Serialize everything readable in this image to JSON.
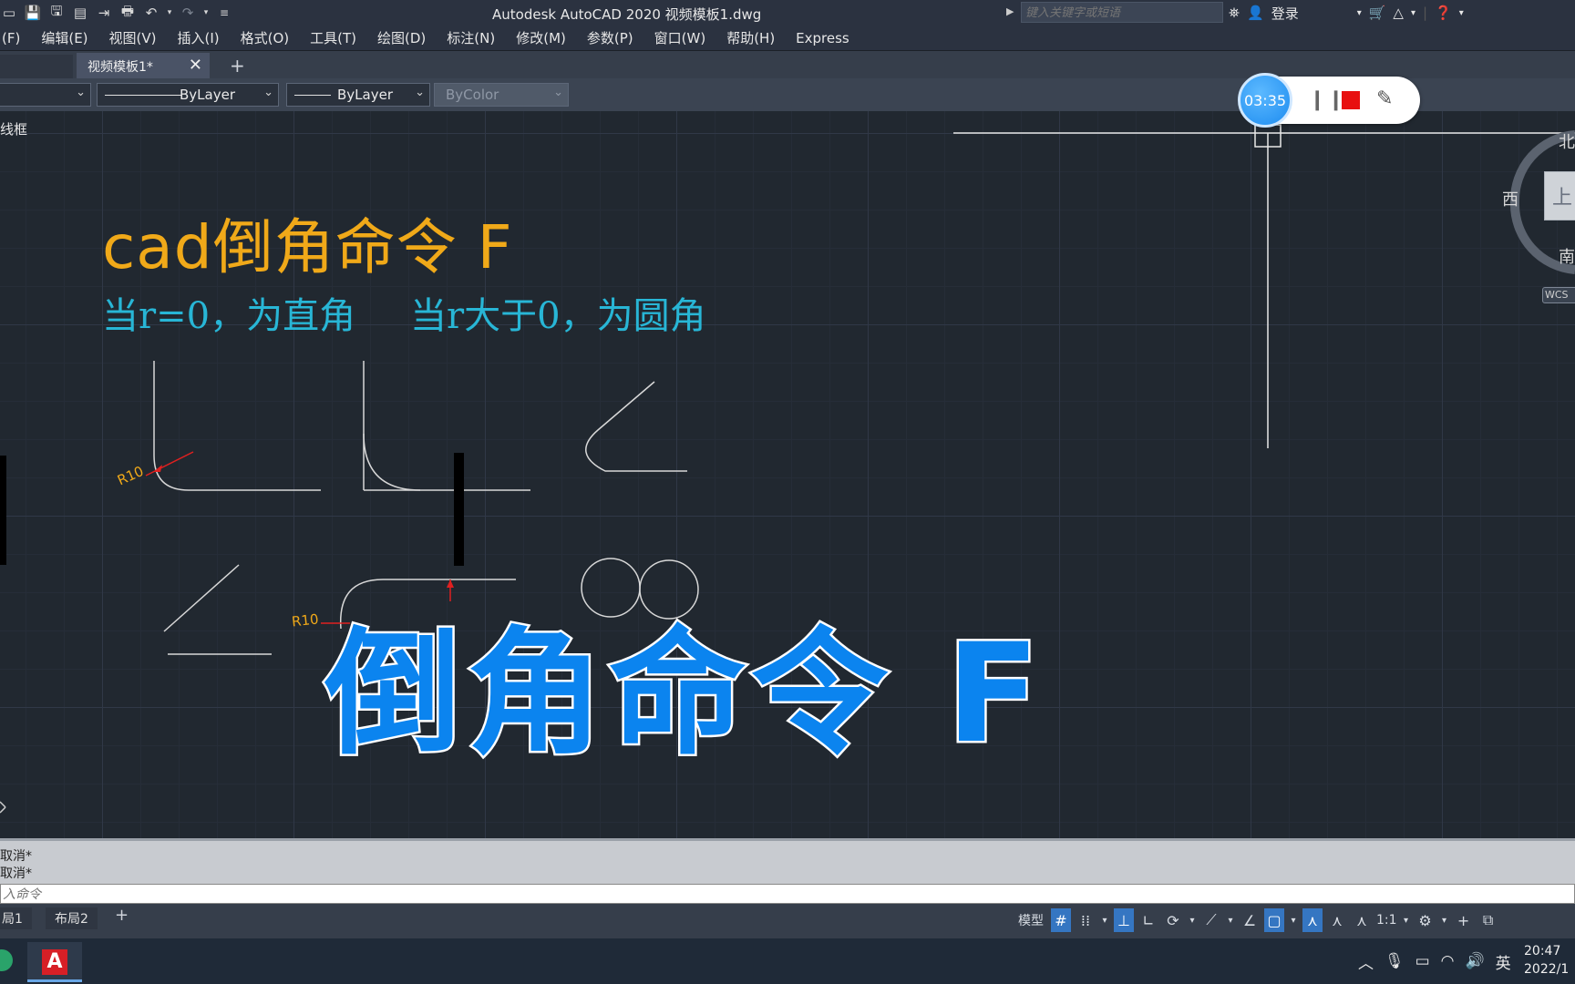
{
  "window": {
    "title": "Autodesk AutoCAD 2020    视频模板1.dwg",
    "search_placeholder": "键入关键字或短语",
    "login_label": "登录"
  },
  "menu": [
    "(F)",
    "编辑(E)",
    "视图(V)",
    "插入(I)",
    "格式(O)",
    "工具(T)",
    "绘图(D)",
    "标注(N)",
    "修改(M)",
    "参数(P)",
    "窗口(W)",
    "帮助(H)",
    "Express"
  ],
  "file_tabs": {
    "active": "视频模板1*",
    "add_icon": "+"
  },
  "properties": {
    "linetype": "ByLayer",
    "lineweight": "ByLayer",
    "plotstyle": "ByColor"
  },
  "viewport_label": "线框",
  "drawing": {
    "title": "cad倒角命令 F",
    "note_left": "当r=0，为直角",
    "note_right": "当r大于0，为圆角",
    "dim_label_1": "R10",
    "dim_label_2": "R10",
    "overlay": "倒角命令 F"
  },
  "recorder": {
    "time": "03:35"
  },
  "viewcube": {
    "north": "北",
    "west": "西",
    "south": "南",
    "top": "上",
    "wcs": "WCS"
  },
  "command": {
    "history": [
      "取消*",
      "取消*"
    ],
    "prompt_placeholder": "入命令"
  },
  "layout_tabs": [
    "局1",
    "布局2"
  ],
  "status": {
    "model": "模型",
    "scale": "1:1"
  },
  "taskbar": {
    "ime": "英",
    "time": "20:47",
    "date": "2022/1"
  },
  "colors": {
    "title_orange": "#f0a919",
    "note_cyan": "#28b6d6",
    "overlay_blue": "#0b84ef",
    "dim_red": "#e02020",
    "record_red": "#e81010"
  }
}
